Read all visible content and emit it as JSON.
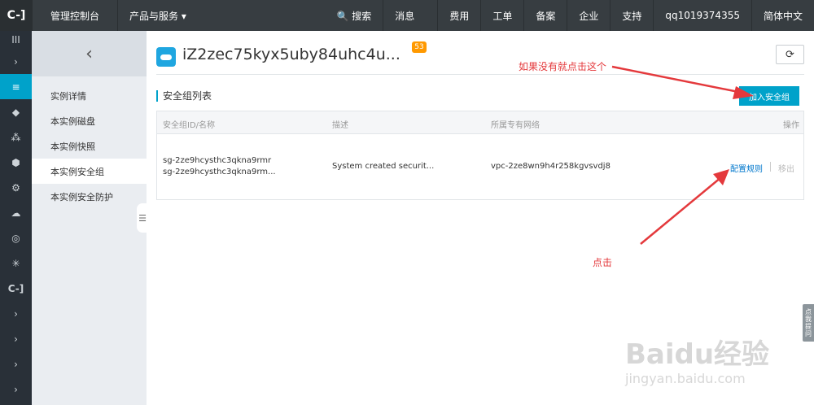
{
  "topbar": {
    "logo": "C-]",
    "console": "管理控制台",
    "products": "产品与服务 ▾",
    "search": "🔍 搜索",
    "messages": "消息",
    "billing": "费用",
    "tickets": "工单",
    "icp": "备案",
    "enterprise": "企业",
    "support": "支持",
    "user": "qq1019374355",
    "language": "简体中文"
  },
  "leftnav": {
    "icons": [
      "menu-icon",
      "expand-icon",
      "server-icon",
      "shield-icon",
      "network-icon",
      "cube-icon",
      "gear-icon",
      "cloud-icon",
      "eye-icon",
      "nodes-icon",
      "logo-icon",
      "expand-icon",
      "expand-icon",
      "expand-icon",
      "expand-icon"
    ],
    "glyphs": [
      "III",
      "›",
      "≡",
      "◆",
      "⁂",
      "⬢",
      "⚙",
      "☁",
      "◎",
      "✳",
      "C-]",
      "›",
      "›",
      "›",
      "›"
    ]
  },
  "subnav": {
    "back": "‹",
    "items": [
      {
        "label": "实例详情"
      },
      {
        "label": "本实例磁盘"
      },
      {
        "label": "本实例快照"
      },
      {
        "label": "本实例安全组"
      },
      {
        "label": "本实例安全防护"
      }
    ],
    "collapse": "☰"
  },
  "main": {
    "instance_title": "iZ2zec75kyx5uby84uhc4u...",
    "badge": "53",
    "refresh": "⟳",
    "section_title": "安全组列表",
    "add_button": "加入安全组",
    "table": {
      "headers": [
        "安全组ID/名称",
        "描述",
        "所属专有网络",
        "操作"
      ],
      "rows": [
        {
          "id": "sg-2ze9hcysthc3qkna9rmr",
          "name": "sg-2ze9hcysthc3qkna9rm...",
          "description": "System created securit...",
          "vpc": "vpc-2ze8wn9h4r258kgvsvdj8",
          "action_config": "配置规则",
          "action_remove": "移出"
        }
      ]
    }
  },
  "annotations": {
    "hint_top": "如果没有就点击这个",
    "hint_click": "点击"
  },
  "float_tab": "点我提问",
  "watermark": {
    "main": "Baidu经验",
    "sub": "jingyan.baidu.com"
  },
  "colors": {
    "topbar_bg": "#373d41",
    "accent": "#00a2ca",
    "badge": "#ff9900",
    "annotation": "#e4393c"
  }
}
